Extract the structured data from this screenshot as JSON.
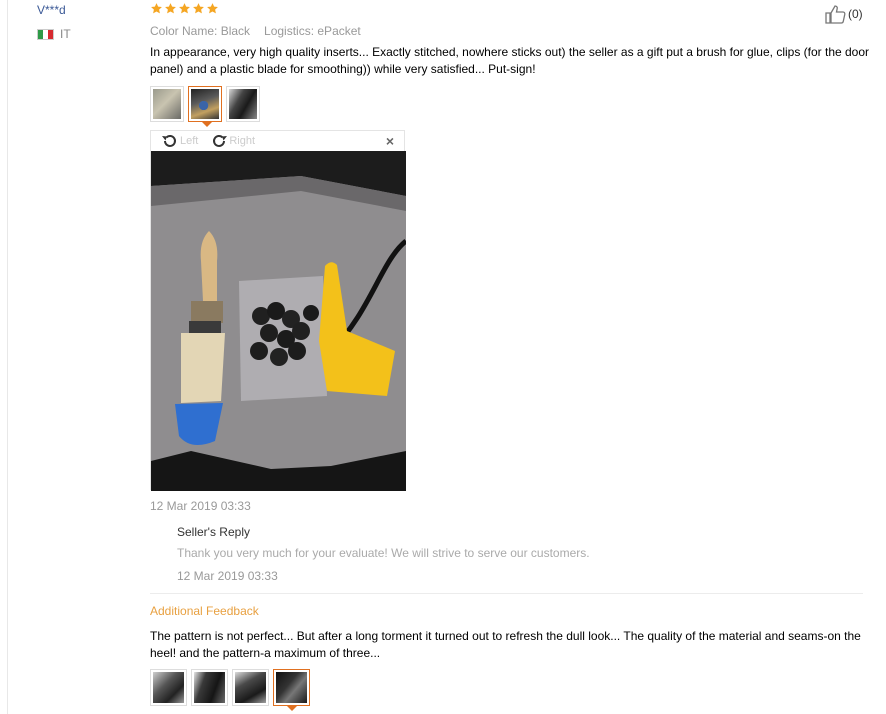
{
  "user": {
    "name": "V***d",
    "country": "IT"
  },
  "rating": {
    "stars": 5
  },
  "attributes": {
    "color": "Color Name: Black",
    "logistics": "Logistics: ePacket"
  },
  "helpful": {
    "count": "(0)"
  },
  "review": {
    "text": "In appearance, very high quality inserts... Exactly stitched, nowhere sticks out) the seller as a gift put a brush for glue, clips (for the door panel) and a plastic blade for smoothing)) while very satisfied... Put-sign!"
  },
  "viewer": {
    "left_label": "Left",
    "right_label": "Right",
    "close": "×"
  },
  "review_date": "12 Mar 2019 03:33",
  "seller_reply": {
    "title": "Seller's Reply",
    "text": "Thank you very much for your evaluate! We will strive to serve our customers.",
    "date": "12 Mar 2019 03:33"
  },
  "additional_feedback": {
    "title": "Additional Feedback",
    "text": "The pattern is not perfect... But after a long torment it turned out to refresh the dull look... The quality of the material and seams-on the heel! and the pattern-a maximum of three..."
  },
  "colors": {
    "star": "#f5a623",
    "accent": "#e07020",
    "link": "#3a5896"
  }
}
